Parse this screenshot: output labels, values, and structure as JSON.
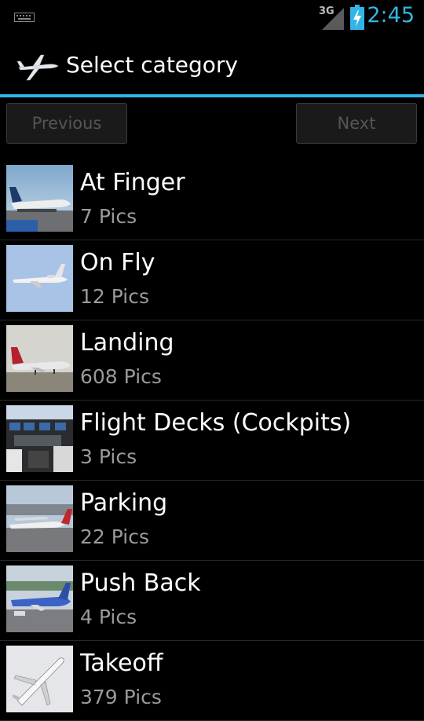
{
  "status_bar": {
    "network": "3G",
    "time": "2:45",
    "clock_color": "#33b5e5"
  },
  "action_bar": {
    "title": "Select category",
    "accent_color": "#33b5e5"
  },
  "nav": {
    "previous_label": "Previous",
    "next_label": "Next"
  },
  "categories": [
    {
      "name": "At Finger",
      "count": "7 Pics",
      "icon": "airport-gate-thumbnail"
    },
    {
      "name": "On Fly",
      "count": "12 Pics",
      "icon": "jet-in-flight-thumbnail"
    },
    {
      "name": "Landing",
      "count": "608 Pics",
      "icon": "plane-landing-thumbnail"
    },
    {
      "name": "Flight Decks (Cockpits)",
      "count": "3 Pics",
      "icon": "cockpit-thumbnail"
    },
    {
      "name": "Parking",
      "count": "22 Pics",
      "icon": "parked-planes-thumbnail"
    },
    {
      "name": "Push Back",
      "count": "4 Pics",
      "icon": "push-back-thumbnail"
    },
    {
      "name": "Takeoff",
      "count": "379 Pics",
      "icon": "plane-takeoff-thumbnail"
    }
  ]
}
